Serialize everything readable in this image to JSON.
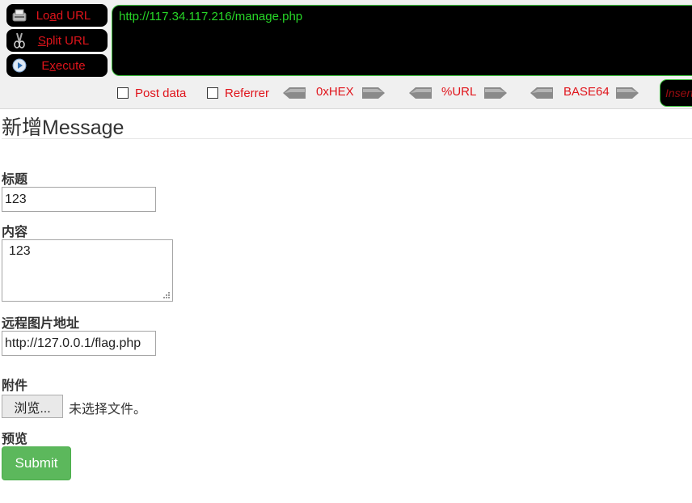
{
  "hackbar": {
    "load_url": "Load URL",
    "split_url": "Split URL",
    "execute": "Execute",
    "url": "http://117.34.117.216/manage.php",
    "post_data": "Post data",
    "referrer": "Referrer",
    "hex": "0xHEX",
    "url_enc": "%URL",
    "base64": "BASE64",
    "insert": "Insert"
  },
  "form": {
    "title": "新增Message",
    "title_label": "标题",
    "title_value": "123",
    "content_label": "内容",
    "content_value": "123",
    "image_label": "远程图片地址",
    "image_value": "http://127.0.0.1/flag.php",
    "attachment_label": "附件",
    "browse_label": "浏览...",
    "file_status": "未选择文件。",
    "preview_label": "预览",
    "submit_label": "Submit"
  },
  "colors": {
    "hackbar_text": "#e0141b",
    "url_text": "#27d627",
    "submit_bg": "#5cb85c"
  }
}
